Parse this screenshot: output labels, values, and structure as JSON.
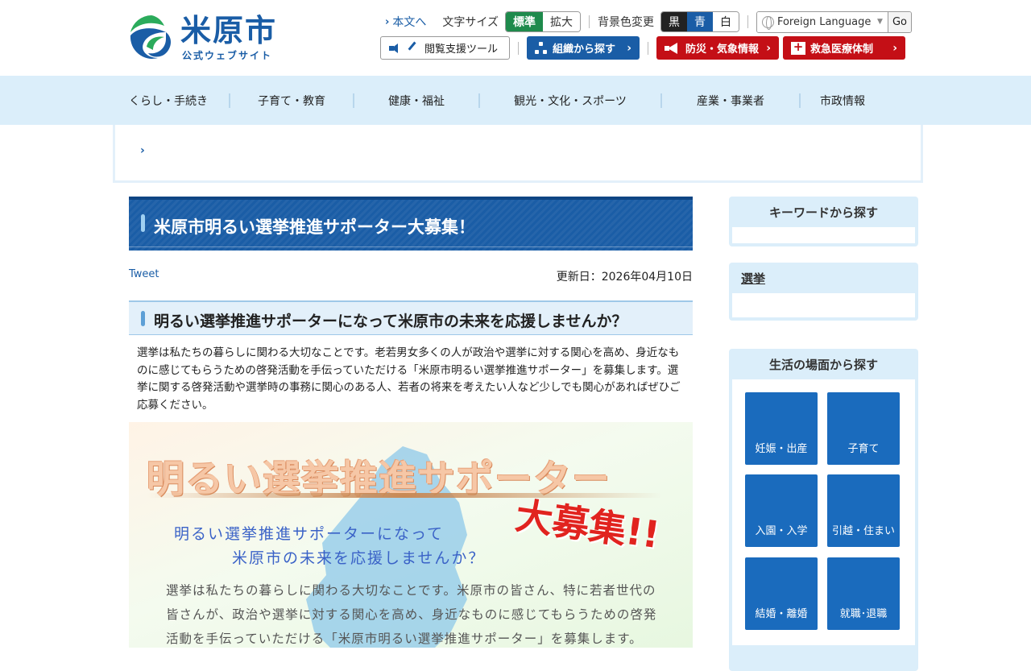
{
  "header": {
    "logo_name": "米原市",
    "logo_sub": "公式ウェブサイト",
    "skip_link": "本文へ",
    "font_size_label": "文字サイズ",
    "font_standard": "標準",
    "font_large": "拡大",
    "bg_color_label": "背景色変更",
    "bg_black": "黒",
    "bg_blue": "青",
    "bg_white": "白",
    "language_select_value": "Foreign Language",
    "language_go": "Go",
    "reading_tool": "閲覧支援ツール",
    "org_search": "組織から探す",
    "disaster_info": "防災・気象情報",
    "emergency_medical": "救急医療体制"
  },
  "gnav": {
    "items": [
      "くらし・手続き",
      "子育て・教育",
      "健康・福祉",
      "観光・文化・スポーツ",
      "産業・事業者",
      "市政情報"
    ]
  },
  "main": {
    "title": "米原市明るい選挙推進サポーター大募集！",
    "tweet": "Tweet",
    "updated": "更新日：2026年04月10日",
    "heading": "明るい選挙推進サポーターになって米原市の未来を応援しませんか？",
    "body": "選挙は私たちの暮らしに関わる大切なことです。老若男女多くの人が政治や選挙に対する関心を高め、身近なものに感じてもらうための啓発活動を手伝っていただける「米原市明るい選挙推進サポーター」を募集します。選挙に関する啓発活動や選挙時の事務に関心のある人、若者の将来を考えたい人など少しでも関心があればぜひご応募ください。",
    "banner": {
      "title": "明るい選挙推進サポーター",
      "boshu": "大募集!!",
      "sub1": "明るい選挙推進サポーターになって",
      "sub2": "米原市の未来を応援しませんか？",
      "body": "選挙は私たちの暮らしに関わる大切なことです。米原市の皆さん、特に若者世代の皆さんが、政治や選挙に対する関心を高め、身近なものに感じてもらうための啓発活動を手伝っていただける「米原市明るい選挙推進サポーター」を募集します。"
    }
  },
  "sidebar": {
    "keyword_heading": "キーワードから探す",
    "category_heading": "選挙",
    "life_heading": "生活の場面から探す",
    "life_tiles": [
      "妊娠・出産",
      "子育て",
      "入園・入学",
      "引越・住まい",
      "結婚・離婚",
      "就職･退職"
    ]
  },
  "colors": {
    "brand_blue": "#1a5da6",
    "nav_bg": "#dbeefa",
    "active_green": "#1e8a4c",
    "alert_red": "#c40f16"
  }
}
